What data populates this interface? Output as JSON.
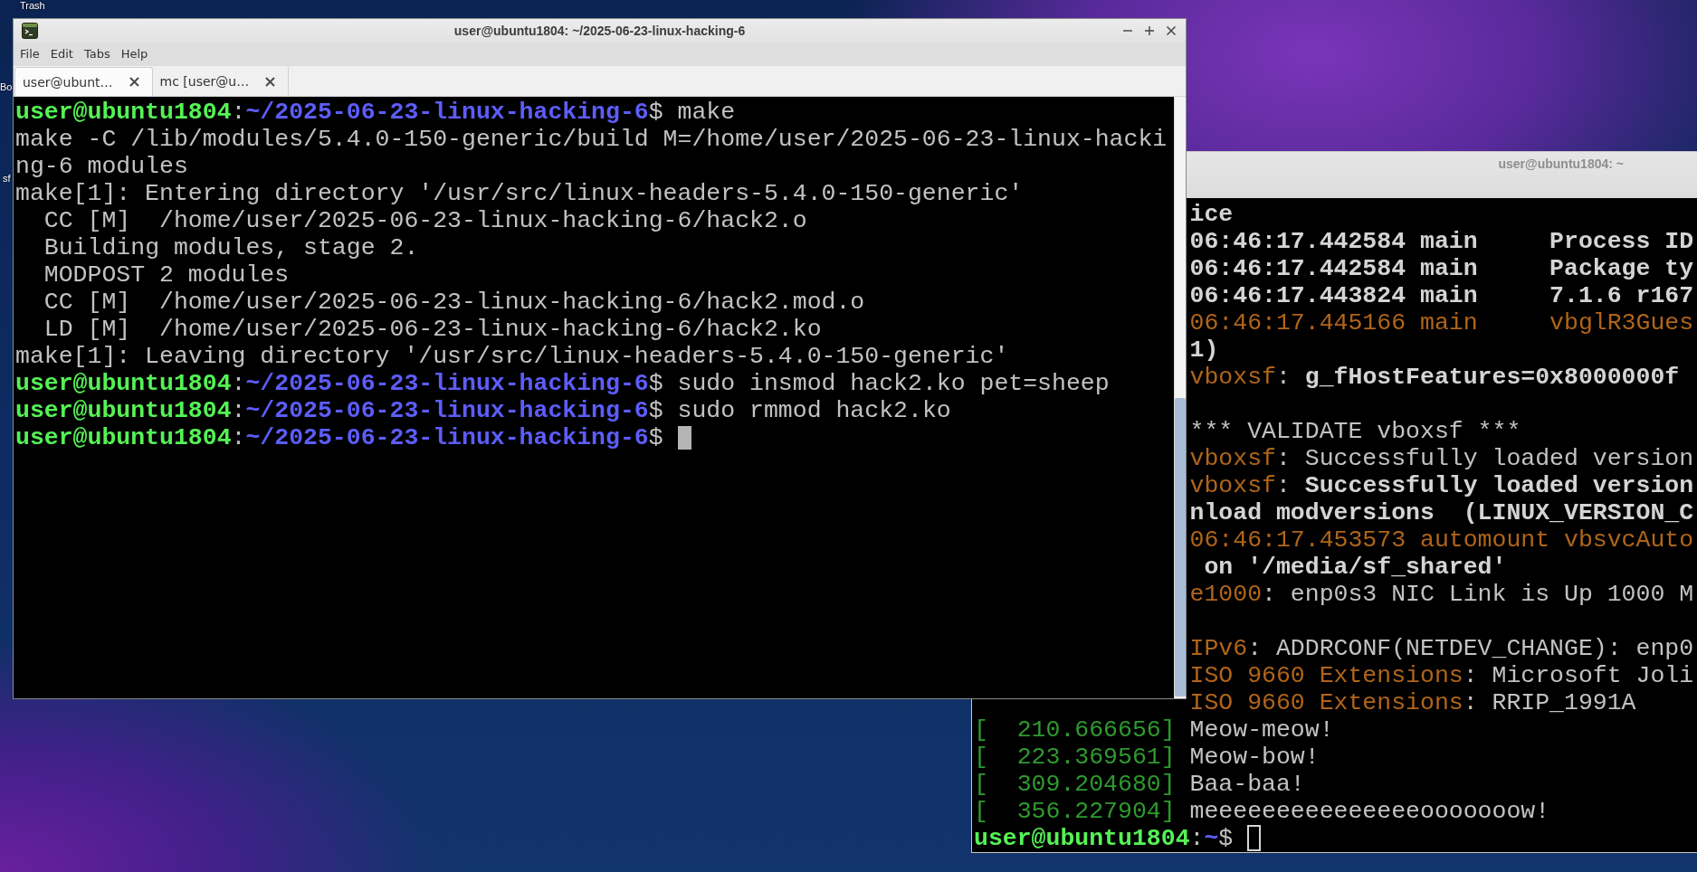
{
  "desktop": {
    "icon_labels": [
      "Trash",
      "Bo",
      "sf"
    ]
  },
  "terminal_window": {
    "title": "user@ubuntu1804: ~/2025-06-23-linux-hacking-6",
    "active": true,
    "menu": [
      "File",
      "Edit",
      "Tabs",
      "Help"
    ],
    "tabs": [
      {
        "label": "user@ubunt…",
        "selected": true
      },
      {
        "label": "mc [user@u…",
        "selected": false
      }
    ],
    "lines": [
      {
        "segments": [
          {
            "kind": "user",
            "text": "user@ubuntu1804"
          },
          {
            "kind": "plain",
            "text": ":"
          },
          {
            "kind": "path",
            "text": "~/2025-06-23-linux-hacking-6"
          },
          {
            "kind": "plain",
            "text": "$ make"
          }
        ]
      },
      {
        "segments": [
          {
            "kind": "plain",
            "text": "make -C /lib/modules/5.4.0-150-generic/build M=/home/user/2025-06-23-linux-hacking-6 modules"
          }
        ]
      },
      {
        "segments": [
          {
            "kind": "plain",
            "text": "make[1]: Entering directory '/usr/src/linux-headers-5.4.0-150-generic'"
          }
        ]
      },
      {
        "segments": [
          {
            "kind": "plain",
            "text": "  CC [M]  /home/user/2025-06-23-linux-hacking-6/hack2.o"
          }
        ]
      },
      {
        "segments": [
          {
            "kind": "plain",
            "text": "  Building modules, stage 2."
          }
        ]
      },
      {
        "segments": [
          {
            "kind": "plain",
            "text": "  MODPOST 2 modules"
          }
        ]
      },
      {
        "segments": [
          {
            "kind": "plain",
            "text": "  CC [M]  /home/user/2025-06-23-linux-hacking-6/hack2.mod.o"
          }
        ]
      },
      {
        "segments": [
          {
            "kind": "plain",
            "text": "  LD [M]  /home/user/2025-06-23-linux-hacking-6/hack2.ko"
          }
        ]
      },
      {
        "segments": [
          {
            "kind": "plain",
            "text": "make[1]: Leaving directory '/usr/src/linux-headers-5.4.0-150-generic'"
          }
        ]
      },
      {
        "segments": [
          {
            "kind": "user",
            "text": "user@ubuntu1804"
          },
          {
            "kind": "plain",
            "text": ":"
          },
          {
            "kind": "path",
            "text": "~/2025-06-23-linux-hacking-6"
          },
          {
            "kind": "plain",
            "text": "$ sudo insmod hack2.ko pet=sheep"
          }
        ]
      },
      {
        "segments": [
          {
            "kind": "user",
            "text": "user@ubuntu1804"
          },
          {
            "kind": "plain",
            "text": ":"
          },
          {
            "kind": "path",
            "text": "~/2025-06-23-linux-hacking-6"
          },
          {
            "kind": "plain",
            "text": "$ sudo rmmod hack2.ko"
          }
        ]
      },
      {
        "segments": [
          {
            "kind": "user",
            "text": "user@ubuntu1804"
          },
          {
            "kind": "plain",
            "text": ":"
          },
          {
            "kind": "path",
            "text": "~/2025-06-23-linux-hacking-6"
          },
          {
            "kind": "plain",
            "text": "$ "
          },
          {
            "kind": "cursor"
          }
        ]
      }
    ]
  },
  "background_window": {
    "title": "user@ubuntu1804: ~",
    "active": false,
    "lines": [
      {
        "kind": "tail",
        "segments": [
          {
            "kind": "bold",
            "text": "ice"
          }
        ]
      },
      {
        "kind": "tail",
        "segments": [
          {
            "kind": "bold",
            "text": "06:46:17.442584 main     Process ID"
          }
        ]
      },
      {
        "kind": "tail",
        "segments": [
          {
            "kind": "bold",
            "text": "06:46:17.442584 main     Package ty"
          }
        ]
      },
      {
        "kind": "tail",
        "segments": [
          {
            "kind": "bold",
            "text": "06:46:17.443824 main     7.1.6 r167"
          }
        ]
      },
      {
        "kind": "tail",
        "segments": [
          {
            "kind": "warn",
            "text": "06:46:17.445166 main     vbglR3Gues"
          }
        ]
      },
      {
        "kind": "tail",
        "segments": [
          {
            "kind": "bold",
            "text": "1)"
          }
        ]
      },
      {
        "kind": "tail",
        "segments": [
          {
            "kind": "warn",
            "text": "vboxsf"
          },
          {
            "kind": "plain",
            "text": ": "
          },
          {
            "kind": "bold",
            "text": "g_fHostFeatures=0x8000000f"
          }
        ]
      },
      {
        "kind": "blank"
      },
      {
        "kind": "tail",
        "segments": [
          {
            "kind": "plain",
            "text": "*** VALIDATE vboxsf ***"
          }
        ]
      },
      {
        "kind": "tail",
        "segments": [
          {
            "kind": "warn",
            "text": "vboxsf"
          },
          {
            "kind": "plain",
            "text": ": Successfully loaded version"
          }
        ]
      },
      {
        "kind": "tail",
        "segments": [
          {
            "kind": "warn",
            "text": "vboxsf"
          },
          {
            "kind": "plain",
            "text": ": "
          },
          {
            "kind": "bold",
            "text": "Successfully loaded version"
          }
        ]
      },
      {
        "kind": "tail",
        "segments": [
          {
            "kind": "bold",
            "text": "nload modversions  (LINUX_VERSION_C"
          }
        ]
      },
      {
        "kind": "tail",
        "segments": [
          {
            "kind": "warn",
            "text": "06:46:17.453573 automount vbsvcAuto"
          }
        ]
      },
      {
        "kind": "tail",
        "segments": [
          {
            "kind": "bold",
            "text": " on '/media/sf_shared'"
          }
        ]
      },
      {
        "kind": "tail",
        "segments": [
          {
            "kind": "warn",
            "text": "e1000"
          },
          {
            "kind": "plain",
            "text": ": enp0s3 NIC Link is Up 1000 M"
          }
        ]
      },
      {
        "kind": "blank"
      },
      {
        "kind": "tail",
        "segments": [
          {
            "kind": "warn",
            "text": "IPv6"
          },
          {
            "kind": "plain",
            "text": ": ADDRCONF(NETDEV_CHANGE): enp0"
          }
        ]
      },
      {
        "kind": "tail",
        "segments": [
          {
            "kind": "warn",
            "text": "ISO 9660 Extensions"
          },
          {
            "kind": "plain",
            "text": ": Microsoft Joli"
          }
        ]
      },
      {
        "kind": "tail",
        "segments": [
          {
            "kind": "warn",
            "text": "ISO 9660 Extensions"
          },
          {
            "kind": "plain",
            "text": ": RRIP_1991A"
          }
        ]
      },
      {
        "kind": "full",
        "segments": [
          {
            "kind": "time",
            "text": "[  210.666656]"
          },
          {
            "kind": "plain",
            "text": " Meow-meow!"
          }
        ]
      },
      {
        "kind": "full",
        "segments": [
          {
            "kind": "time",
            "text": "[  223.369561]"
          },
          {
            "kind": "plain",
            "text": " Meow-bow!"
          }
        ]
      },
      {
        "kind": "full",
        "segments": [
          {
            "kind": "time",
            "text": "[  309.204680]"
          },
          {
            "kind": "plain",
            "text": " Baa-baa!"
          }
        ]
      },
      {
        "kind": "full",
        "segments": [
          {
            "kind": "time",
            "text": "[  356.227904]"
          },
          {
            "kind": "plain",
            "text": " meeeeeeeeeeeeeeeooooooow!"
          }
        ]
      },
      {
        "kind": "full",
        "segments": [
          {
            "kind": "user",
            "text": "user@ubuntu1804"
          },
          {
            "kind": "plain",
            "text": ":"
          },
          {
            "kind": "path",
            "text": "~"
          },
          {
            "kind": "plain",
            "text": "$ "
          },
          {
            "kind": "cursor"
          }
        ]
      }
    ]
  }
}
